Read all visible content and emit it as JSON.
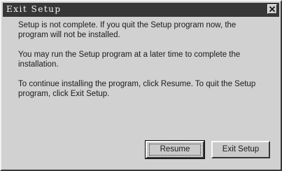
{
  "window": {
    "title": "Exit Setup"
  },
  "messages": [
    "Setup is not complete.  If you quit the Setup program now, the program will not be installed.",
    "You may run the Setup program at a later time to complete the installation.",
    "To continue installing the program, click Resume.  To quit the Setup program, click Exit Setup."
  ],
  "buttons": {
    "resume_label": "Resume",
    "exit_label": "Exit Setup"
  },
  "icons": {
    "close": "close-icon"
  }
}
